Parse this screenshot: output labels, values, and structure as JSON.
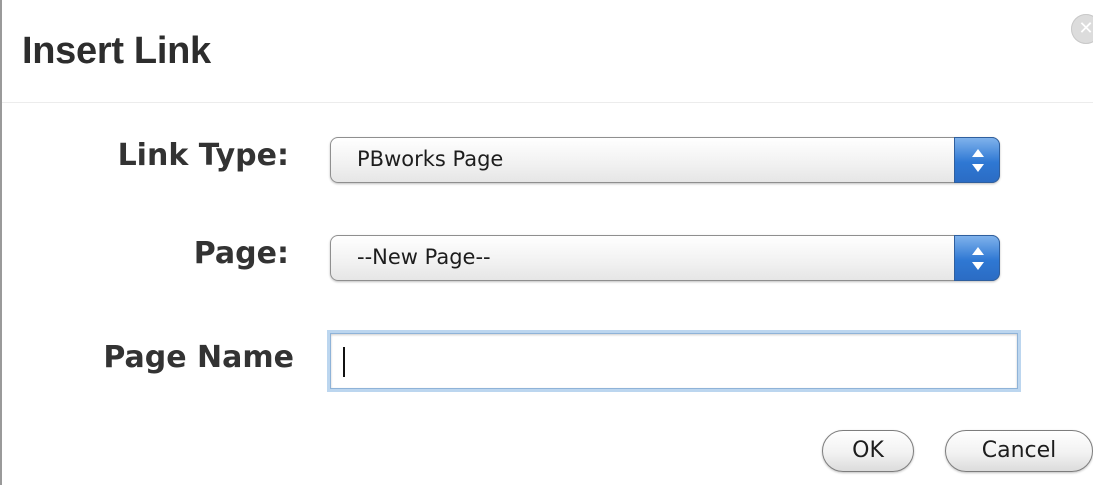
{
  "dialog": {
    "title": "Insert Link",
    "close_icon": "close-icon"
  },
  "form": {
    "link_type_label": "Link Type:",
    "link_type_value": "PBworks Page",
    "page_label": "Page:",
    "page_value": "--New Page--",
    "page_name_label": "Page Name",
    "page_name_value": ""
  },
  "buttons": {
    "ok_label": "OK",
    "cancel_label": "Cancel"
  },
  "colors": {
    "stepper_accent": "#2f78d3",
    "focus_ring": "#bcd6ef"
  }
}
